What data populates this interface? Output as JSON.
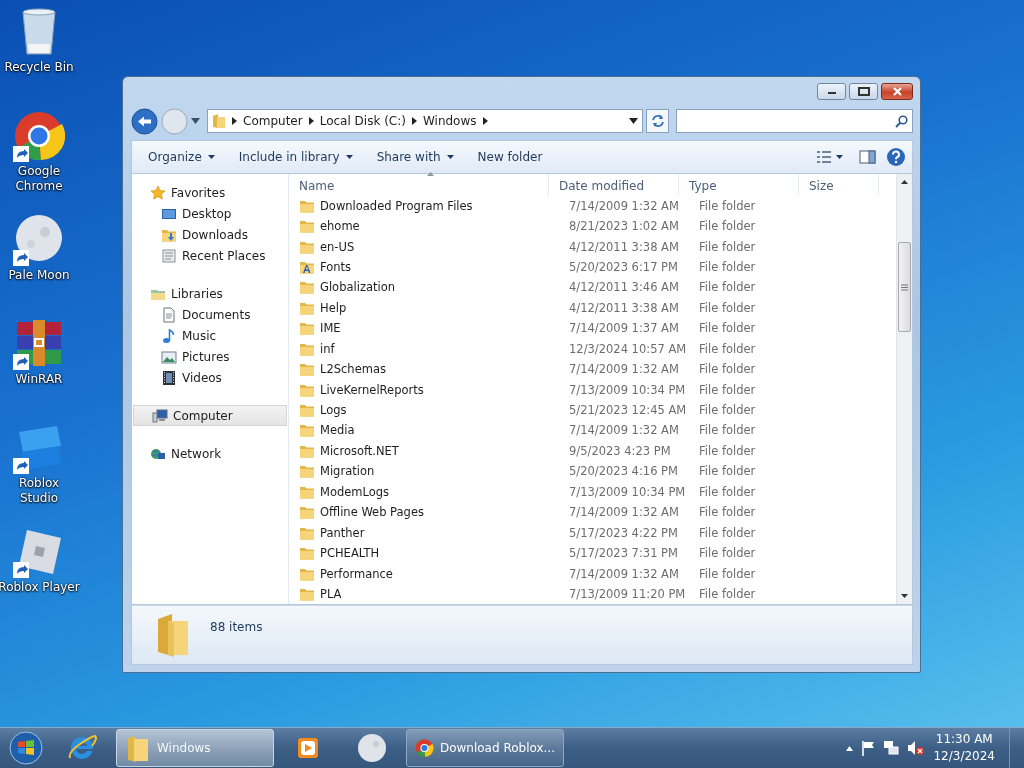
{
  "desktop_icons": [
    {
      "label": "Recycle Bin",
      "kind": "recycle",
      "shortcut": false
    },
    {
      "label": "Google Chrome",
      "kind": "chrome",
      "shortcut": true
    },
    {
      "label": "Pale Moon",
      "kind": "moon",
      "shortcut": true
    },
    {
      "label": "WinRAR",
      "kind": "winrar",
      "shortcut": true
    },
    {
      "label": "Roblox Studio",
      "kind": "studio",
      "shortcut": true
    },
    {
      "label": "Roblox Player",
      "kind": "player",
      "shortcut": true
    }
  ],
  "window": {
    "breadcrumb": [
      "Computer",
      "Local Disk (C:)",
      "Windows"
    ],
    "toolbar": [
      {
        "label": "Organize",
        "dropdown": true
      },
      {
        "label": "Include in library",
        "dropdown": true
      },
      {
        "label": "Share with",
        "dropdown": true
      },
      {
        "label": "New folder",
        "dropdown": false
      }
    ],
    "nav": [
      {
        "label": "Favorites",
        "kind": "star",
        "selected": false,
        "children": [
          {
            "label": "Desktop",
            "kind": "desktop",
            "selected": false
          },
          {
            "label": "Downloads",
            "kind": "downloads",
            "selected": false
          },
          {
            "label": "Recent Places",
            "kind": "recent",
            "selected": false
          }
        ]
      },
      {
        "label": "Libraries",
        "kind": "libraries",
        "selected": false,
        "children": [
          {
            "label": "Documents",
            "kind": "documents",
            "selected": false
          },
          {
            "label": "Music",
            "kind": "music",
            "selected": false
          },
          {
            "label": "Pictures",
            "kind": "pictures",
            "selected": false
          },
          {
            "label": "Videos",
            "kind": "videos",
            "selected": false
          }
        ]
      },
      {
        "label": "Computer",
        "kind": "computer",
        "selected": true
      },
      {
        "label": "Network",
        "kind": "network",
        "selected": false
      }
    ],
    "columns": [
      {
        "label": "Name",
        "sorted": true
      },
      {
        "label": "Date modified",
        "sorted": false
      },
      {
        "label": "Type",
        "sorted": false
      },
      {
        "label": "Size",
        "sorted": false
      }
    ],
    "rows": [
      {
        "name": "Downloaded Program Files",
        "date": "7/14/2009 1:32 AM",
        "type": "File folder",
        "kind": "folder"
      },
      {
        "name": "ehome",
        "date": "8/21/2023 1:02 AM",
        "type": "File folder",
        "kind": "folder"
      },
      {
        "name": "en-US",
        "date": "4/12/2011 3:38 AM",
        "type": "File folder",
        "kind": "folder"
      },
      {
        "name": "Fonts",
        "date": "5/20/2023 6:17 PM",
        "type": "File folder",
        "kind": "fonts"
      },
      {
        "name": "Globalization",
        "date": "4/12/2011 3:46 AM",
        "type": "File folder",
        "kind": "folder"
      },
      {
        "name": "Help",
        "date": "4/12/2011 3:38 AM",
        "type": "File folder",
        "kind": "folder"
      },
      {
        "name": "IME",
        "date": "7/14/2009 1:37 AM",
        "type": "File folder",
        "kind": "folder"
      },
      {
        "name": "inf",
        "date": "12/3/2024 10:57 AM",
        "type": "File folder",
        "kind": "folder"
      },
      {
        "name": "L2Schemas",
        "date": "7/14/2009 1:32 AM",
        "type": "File folder",
        "kind": "folder"
      },
      {
        "name": "LiveKernelReports",
        "date": "7/13/2009 10:34 PM",
        "type": "File folder",
        "kind": "folder"
      },
      {
        "name": "Logs",
        "date": "5/21/2023 12:45 AM",
        "type": "File folder",
        "kind": "folder"
      },
      {
        "name": "Media",
        "date": "7/14/2009 1:32 AM",
        "type": "File folder",
        "kind": "folder"
      },
      {
        "name": "Microsoft.NET",
        "date": "9/5/2023 4:23 PM",
        "type": "File folder",
        "kind": "folder"
      },
      {
        "name": "Migration",
        "date": "5/20/2023 4:16 PM",
        "type": "File folder",
        "kind": "folder"
      },
      {
        "name": "ModemLogs",
        "date": "7/13/2009 10:34 PM",
        "type": "File folder",
        "kind": "folder"
      },
      {
        "name": "Offline Web Pages",
        "date": "7/14/2009 1:32 AM",
        "type": "File folder",
        "kind": "folder"
      },
      {
        "name": "Panther",
        "date": "5/17/2023 4:22 PM",
        "type": "File folder",
        "kind": "folder"
      },
      {
        "name": "PCHEALTH",
        "date": "5/17/2023 7:31 PM",
        "type": "File folder",
        "kind": "folder"
      },
      {
        "name": "Performance",
        "date": "7/14/2009 1:32 AM",
        "type": "File folder",
        "kind": "folder"
      },
      {
        "name": "PLA",
        "date": "7/13/2009 11:20 PM",
        "type": "File folder",
        "kind": "folder"
      }
    ],
    "status": "88 items"
  },
  "taskbar": {
    "items": [
      {
        "kind": "ie",
        "selected": false
      },
      {
        "label": "Windows",
        "kind": "explorer",
        "selected": true
      },
      {
        "kind": "media",
        "selected": false
      },
      {
        "kind": "moon",
        "selected": false
      },
      {
        "label": "Download Roblox...",
        "kind": "chrome",
        "selected": false
      }
    ],
    "time": "11:30 AM",
    "date": "12/3/2024"
  }
}
